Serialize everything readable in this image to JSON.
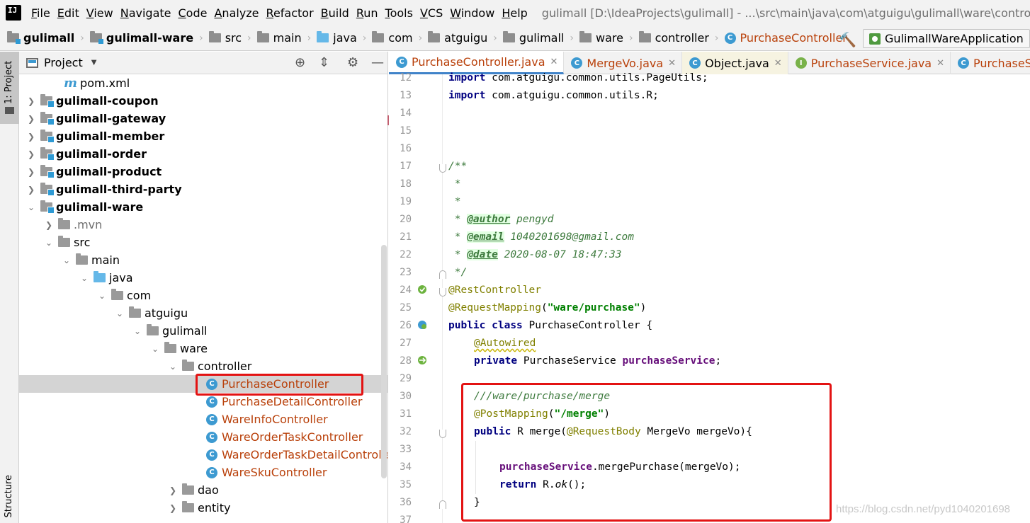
{
  "menubar": {
    "logo": "IJ",
    "items": [
      "File",
      "Edit",
      "View",
      "Navigate",
      "Code",
      "Analyze",
      "Refactor",
      "Build",
      "Run",
      "Tools",
      "VCS",
      "Window",
      "Help"
    ],
    "window_title": "gulimall [D:\\IdeaProjects\\gulimall] - ...\\src\\main\\java\\com\\atguigu\\gulimall\\ware\\controller\\PurchaseController.java [gulimall-ware] - IntelliJ IDEA"
  },
  "breadcrumb": {
    "items": [
      "gulimall",
      "gulimall-ware",
      "src",
      "main",
      "java",
      "com",
      "atguigu",
      "gulimall",
      "ware",
      "controller",
      "PurchaseController"
    ],
    "run_config": "GulimallWareApplication"
  },
  "tool_strip": {
    "project_tab": "1: Project",
    "structure_tab": "Structure"
  },
  "project_panel": {
    "title": "Project",
    "tree": [
      {
        "label": "pom.xml"
      },
      {
        "label": "gulimall-coupon"
      },
      {
        "label": "gulimall-gateway"
      },
      {
        "label": "gulimall-member"
      },
      {
        "label": "gulimall-order"
      },
      {
        "label": "gulimall-product"
      },
      {
        "label": "gulimall-third-party"
      },
      {
        "label": "gulimall-ware"
      },
      {
        "label": ".mvn"
      },
      {
        "label": "src"
      },
      {
        "label": "main"
      },
      {
        "label": "java"
      },
      {
        "label": "com"
      },
      {
        "label": "atguigu"
      },
      {
        "label": "gulimall"
      },
      {
        "label": "ware"
      },
      {
        "label": "controller"
      },
      {
        "label": "PurchaseController"
      },
      {
        "label": "PurchaseDetailController"
      },
      {
        "label": "WareInfoController"
      },
      {
        "label": "WareOrderTaskController"
      },
      {
        "label": "WareOrderTaskDetailController"
      },
      {
        "label": "WareSkuController"
      },
      {
        "label": "dao"
      },
      {
        "label": "entity"
      }
    ]
  },
  "editor": {
    "tabs": [
      {
        "label": "PurchaseController.java",
        "icon": "C"
      },
      {
        "label": "MergeVo.java",
        "icon": "C"
      },
      {
        "label": "Object.java",
        "icon": "C"
      },
      {
        "label": "PurchaseService.java",
        "icon": "I"
      },
      {
        "label": "PurchaseServiceIm",
        "icon": "C"
      }
    ],
    "line_numbers": [
      "12",
      "13",
      "14",
      "15",
      "16",
      "17",
      "18",
      "19",
      "20",
      "21",
      "22",
      "23",
      "24",
      "25",
      "26",
      "27",
      "28",
      "29",
      "30",
      "31",
      "32",
      "33",
      "34",
      "35",
      "36",
      "37"
    ],
    "code": {
      "l12_kw": "import",
      "l12_rest": " com.atguigu.common.utils.PageUtils;",
      "l13_kw": "import",
      "l13_rest": " com.atguigu.common.utils.R;",
      "l17": "/**",
      "l18": " *",
      "l19": " *",
      "l20_pre": " * ",
      "l20_tag": "@author",
      "l20_val": " pengyd",
      "l21_pre": " * ",
      "l21_tag": "@email",
      "l21_val": " 1040201698@gmail.com",
      "l22_pre": " * ",
      "l22_tag": "@date",
      "l22_val": " 2020-08-07 18:47:33",
      "l23": " */",
      "l24": "@RestController",
      "l25_ann": "@RequestMapping",
      "l25_p1": "(",
      "l25_str": "\"ware/purchase\"",
      "l25_p2": ")",
      "l26_kw1": "public",
      "l26_kw2": "class",
      "l26_rest": " PurchaseController {",
      "l27": "@Autowired",
      "l28_kw": "private",
      "l28_type": " PurchaseService ",
      "l28_field": "purchaseService",
      "l28_end": ";",
      "l30": "///ware/purchase/merge",
      "l31_ann": "@PostMapping",
      "l31_p1": "(",
      "l31_str": "\"/merge\"",
      "l31_p2": ")",
      "l32_kw": "public",
      "l32_a": " R merge(",
      "l32_ann": "@RequestBody",
      "l32_b": " MergeVo mergeVo){",
      "l34_field": "purchaseService",
      "l34_rest": ".mergePurchase(mergeVo);",
      "l35_kw": "return",
      "l35_a": " R.",
      "l35_ital": "ok",
      "l35_b": "();",
      "l36": "}"
    }
  },
  "watermark": "https://blog.csdn.net/pyd1040201698"
}
